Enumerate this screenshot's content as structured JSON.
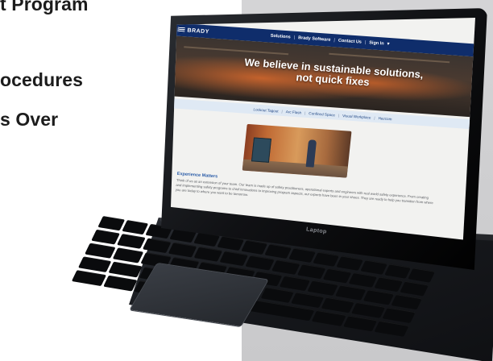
{
  "headline_lines": [
    "t Program",
    "ocedures",
    "s Over"
  ],
  "laptop": {
    "label": "Laptop"
  },
  "site": {
    "brand": "BRADY",
    "nav": {
      "items": [
        "Solutions",
        "Brady Software",
        "Contact Us",
        "Sign In"
      ],
      "separator": "|",
      "signin_suffix": "▾"
    },
    "hero": {
      "title_line1": "We believe in sustainable solutions,",
      "title_line2": "not quick fixes"
    },
    "subnav": {
      "items": [
        "Lockout Tagout",
        "Arc Flash",
        "Confined Space",
        "Visual Workplace",
        "Hazcom"
      ],
      "separator": "|"
    },
    "content": {
      "heading": "Experience Matters",
      "paragraph": "Think of us as an extension of your team. Our team is made up of safety practitioners, operational experts and engineers with real world safety experience. From creating and implementing safety programs to chief innovations to improving program aspects, our experts have been in your shoes. They are ready to help you transition from where you are today to where you want to be tomorrow."
    }
  },
  "colors": {
    "nav_bg": "#0f2d6b",
    "subnav_bg": "#dfe9f4",
    "accent_heading": "#2b5da8",
    "grey_panel": "#d4d4d6",
    "headline_text": "#1c1c1c"
  }
}
